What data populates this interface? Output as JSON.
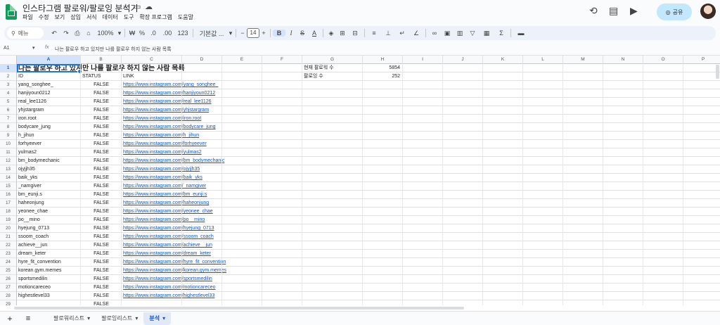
{
  "app": {
    "title": "인스타그램 팔로워/팔로잉 분석기",
    "menu": [
      "파일",
      "수정",
      "보기",
      "삽입",
      "서식",
      "데이터",
      "도구",
      "확장 프로그램",
      "도움말"
    ],
    "share_label": "공유"
  },
  "toolbar": {
    "search_label": "메뉴",
    "zoom": "100%",
    "currency": "₩",
    "percent": "%",
    "dec_decrease": ".0",
    "dec_increase": ".00",
    "number_format": "123",
    "font": "기본값 ...",
    "font_size": "14",
    "minus": "−",
    "plus": "+"
  },
  "formula_bar": {
    "cell_ref": "A1",
    "fx": "fx",
    "content": "나는 팔로우 하고 있지만 나를 팔로우 하지 않는 사람 목록"
  },
  "columns": [
    "A",
    "B",
    "C",
    "D",
    "E",
    "F",
    "G",
    "H",
    "I",
    "J",
    "K",
    "L",
    "M",
    "N",
    "O",
    "P",
    "Q"
  ],
  "sheet": {
    "title": "나는 팔로우 하고 있지만 나를 팔로우 하지 않는 사람 목록",
    "headers": {
      "id": "ID",
      "status": "STATUS",
      "link": "LINK"
    },
    "stats": [
      {
        "label": "현재 팔로워 수",
        "value": "5854"
      },
      {
        "label": "팔로잉 수",
        "value": "252"
      }
    ],
    "rows": [
      {
        "n": "3",
        "id": "yang_songhee_",
        "status": "FALSE",
        "link": "https://www.instagram.com/yang_songhee_"
      },
      {
        "n": "4",
        "id": "hanjiyoun0212",
        "status": "FALSE",
        "link": "https://www.instagram.com/hanjiyoun0212"
      },
      {
        "n": "5",
        "id": "real_lee1126",
        "status": "FALSE",
        "link": "https://www.instagram.com/real_lee1126"
      },
      {
        "n": "6",
        "id": "yhjstargram",
        "status": "FALSE",
        "link": "https://www.instagram.com/yhjstargram"
      },
      {
        "n": "7",
        "id": "iron.root",
        "status": "FALSE",
        "link": "https://www.instagram.com/iron.root"
      },
      {
        "n": "8",
        "id": "bodycare_jung",
        "status": "FALSE",
        "link": "https://www.instagram.com/bodycare_jung"
      },
      {
        "n": "9",
        "id": "h_jihun",
        "status": "FALSE",
        "link": "https://www.instagram.com/h_jihun"
      },
      {
        "n": "10",
        "id": "forhyeever",
        "status": "FALSE",
        "link": "https://www.instagram.com/forhyeever"
      },
      {
        "n": "11",
        "id": "yulmas2",
        "status": "FALSE",
        "link": "https://www.instagram.com/yulmas2"
      },
      {
        "n": "12",
        "id": "bm_bodymechanic",
        "status": "FALSE",
        "link": "https://www.instagram.com/bm_bodymechanic"
      },
      {
        "n": "13",
        "id": "ojyjjh35",
        "status": "FALSE",
        "link": "https://www.instagram.com/ojyjjh35"
      },
      {
        "n": "14",
        "id": "baik_yks",
        "status": "FALSE",
        "link": "https://www.instagram.com/baik_yks"
      },
      {
        "n": "15",
        "id": "_namgiver",
        "status": "FALSE",
        "link": "https://www.instagram.com/_namgiver"
      },
      {
        "n": "16",
        "id": "bm_eunji.s",
        "status": "FALSE",
        "link": "https://www.instagram.com/bm_eunji.s"
      },
      {
        "n": "17",
        "id": "haheonjung",
        "status": "FALSE",
        "link": "https://www.instagram.com/haheonjung"
      },
      {
        "n": "18",
        "id": "yeonee_chae",
        "status": "FALSE",
        "link": "https://www.instagram.com/yeonee_chae"
      },
      {
        "n": "19",
        "id": "po__mino",
        "status": "FALSE",
        "link": "https://www.instagram.com/po__mino"
      },
      {
        "n": "20",
        "id": "hyejung_0713",
        "status": "FALSE",
        "link": "https://www.instagram.com/hyejung_0713"
      },
      {
        "n": "21",
        "id": "ssoom_coach",
        "status": "FALSE",
        "link": "https://www.instagram.com/ssoom_coach"
      },
      {
        "n": "22",
        "id": "achieve__jun",
        "status": "FALSE",
        "link": "https://www.instagram.com/achieve__jun"
      },
      {
        "n": "23",
        "id": "dream_keter",
        "status": "FALSE",
        "link": "https://www.instagram.com/dream_keter"
      },
      {
        "n": "24",
        "id": "hyre_fit_convention",
        "status": "FALSE",
        "link": "https://www.instagram.com/hyre_fit_convention"
      },
      {
        "n": "25",
        "id": "korean.gym.memes",
        "status": "FALSE",
        "link": "https://www.instagram.com/korean.gym.memes"
      },
      {
        "n": "26",
        "id": "sportsmedilin",
        "status": "FALSE",
        "link": "https://www.instagram.com/sportsmedilin"
      },
      {
        "n": "27",
        "id": "motioncareceo",
        "status": "FALSE",
        "link": "https://www.instagram.com/motioncareceo"
      },
      {
        "n": "28",
        "id": "highestlevel33",
        "status": "FALSE",
        "link": "https://www.instagram.com/highestlevel33"
      },
      {
        "n": "29",
        "id": "",
        "status": "FALSE",
        "link": ""
      }
    ]
  },
  "tabs": [
    {
      "label": "팔로워리스트",
      "active": false
    },
    {
      "label": "팔로잉리스트",
      "active": false
    },
    {
      "label": "분석",
      "active": true
    }
  ]
}
